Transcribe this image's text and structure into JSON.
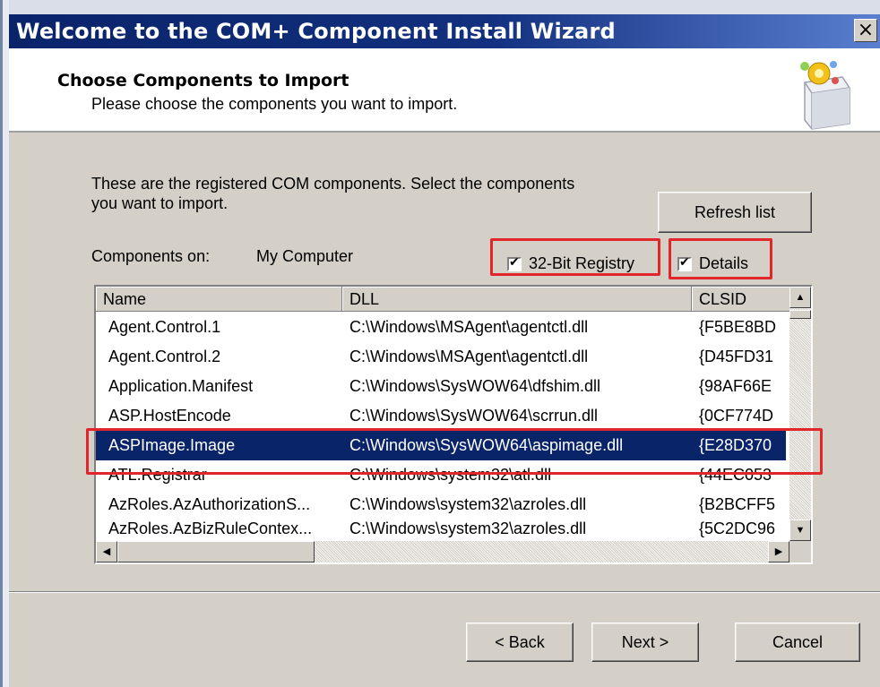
{
  "window": {
    "title": "Welcome to the COM+ Component Install Wizard",
    "close_label": "×"
  },
  "header": {
    "title": "Choose Components to Import",
    "subtitle": "Please choose the components you want to import."
  },
  "intro_text": "These are the registered COM components.  Select the components you want to import.",
  "refresh_label": "Refresh list",
  "components_on": {
    "label": "Components on:",
    "value": "My Computer"
  },
  "checkboxes": [
    {
      "label": "32-Bit Registry",
      "checked": true
    },
    {
      "label": "Details",
      "checked": true
    }
  ],
  "list": {
    "columns": [
      "Name",
      "DLL",
      "CLSID"
    ],
    "rows": [
      {
        "name": "Agent.Control.1",
        "dll": "C:\\Windows\\MSAgent\\agentctl.dll",
        "clsid": "{F5BE8BD"
      },
      {
        "name": "Agent.Control.2",
        "dll": "C:\\Windows\\MSAgent\\agentctl.dll",
        "clsid": "{D45FD31"
      },
      {
        "name": "Application.Manifest",
        "dll": "C:\\Windows\\SysWOW64\\dfshim.dll",
        "clsid": "{98AF66E"
      },
      {
        "name": "ASP.HostEncode",
        "dll": "C:\\Windows\\SysWOW64\\scrrun.dll",
        "clsid": "{0CF774D"
      },
      {
        "name": "ASPImage.Image",
        "dll": "C:\\Windows\\SysWOW64\\aspimage.dll",
        "clsid": "{E28D370"
      },
      {
        "name": "ATL.Registrar",
        "dll": "C:\\Windows\\system32\\atl.dll",
        "clsid": "{44EC053"
      },
      {
        "name": "AzRoles.AzAuthorizationS...",
        "dll": "C:\\Windows\\system32\\azroles.dll",
        "clsid": "{B2BCFF5"
      },
      {
        "name": "AzRoles.AzBizRuleContex...",
        "dll": "C:\\Windows\\system32\\azroles.dll",
        "clsid": "{5C2DC96"
      }
    ],
    "selected_index": 4
  },
  "buttons": {
    "back": "< Back",
    "next": "Next >",
    "cancel": "Cancel"
  },
  "colors": {
    "titlebar": "#0a246a",
    "dialog_bg": "#d4d0c8",
    "selection": "#0a246a",
    "highlight_box": "#e0262a"
  },
  "icons": {
    "wizard": "component-box-icon",
    "scroll_up": "scroll-up-arrow-icon",
    "scroll_down": "scroll-down-arrow-icon",
    "scroll_left": "scroll-left-arrow-icon",
    "scroll_right": "scroll-right-arrow-icon"
  }
}
